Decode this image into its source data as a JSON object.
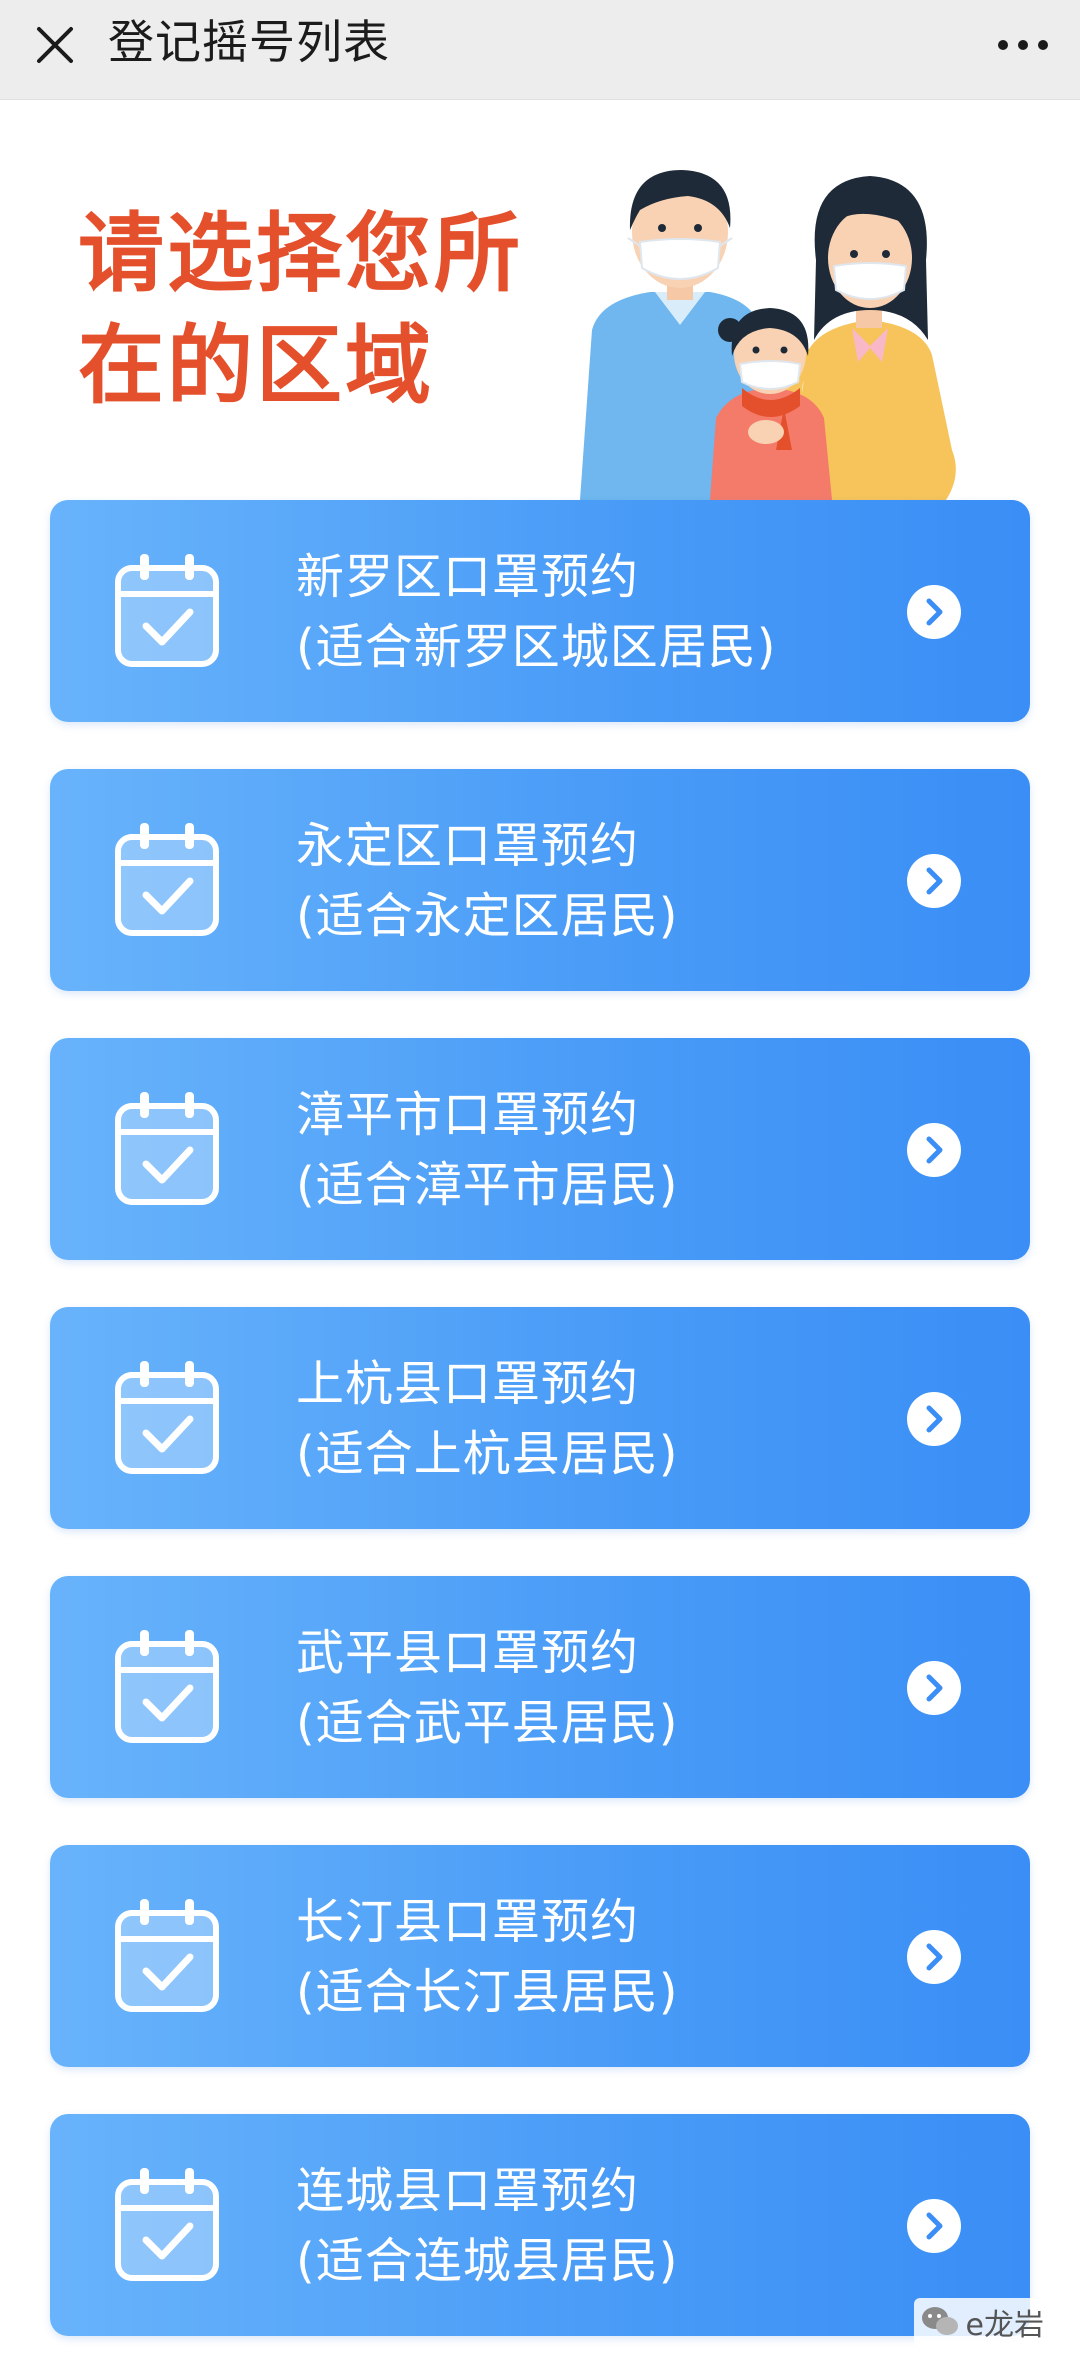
{
  "topbar": {
    "title": "登记摇号列表",
    "close_icon": "close-icon",
    "more_icon": "more-dots-icon"
  },
  "header": {
    "headline": "请选择您所在的区域",
    "illustration": "family-with-masks-illustration"
  },
  "colors": {
    "headline": "#e5502c",
    "card_start": "#68b3fb",
    "card_end": "#3a8ef5",
    "topbar_bg": "#ededed"
  },
  "regions": [
    {
      "title": "新罗区口罩预约",
      "subtitle": "(适合新罗区城区居民)"
    },
    {
      "title": "永定区口罩预约",
      "subtitle": "(适合永定区居民)"
    },
    {
      "title": "漳平市口罩预约",
      "subtitle": "(适合漳平市居民)"
    },
    {
      "title": "上杭县口罩预约",
      "subtitle": "(适合上杭县居民)"
    },
    {
      "title": "武平县口罩预约",
      "subtitle": "(适合武平县居民)"
    },
    {
      "title": "长汀县口罩预约",
      "subtitle": "(适合长汀县居民)"
    },
    {
      "title": "连城县口罩预约",
      "subtitle": "(适合连城县居民)"
    }
  ],
  "watermark": {
    "text": "e龙岩",
    "icon": "wechat-icon"
  }
}
